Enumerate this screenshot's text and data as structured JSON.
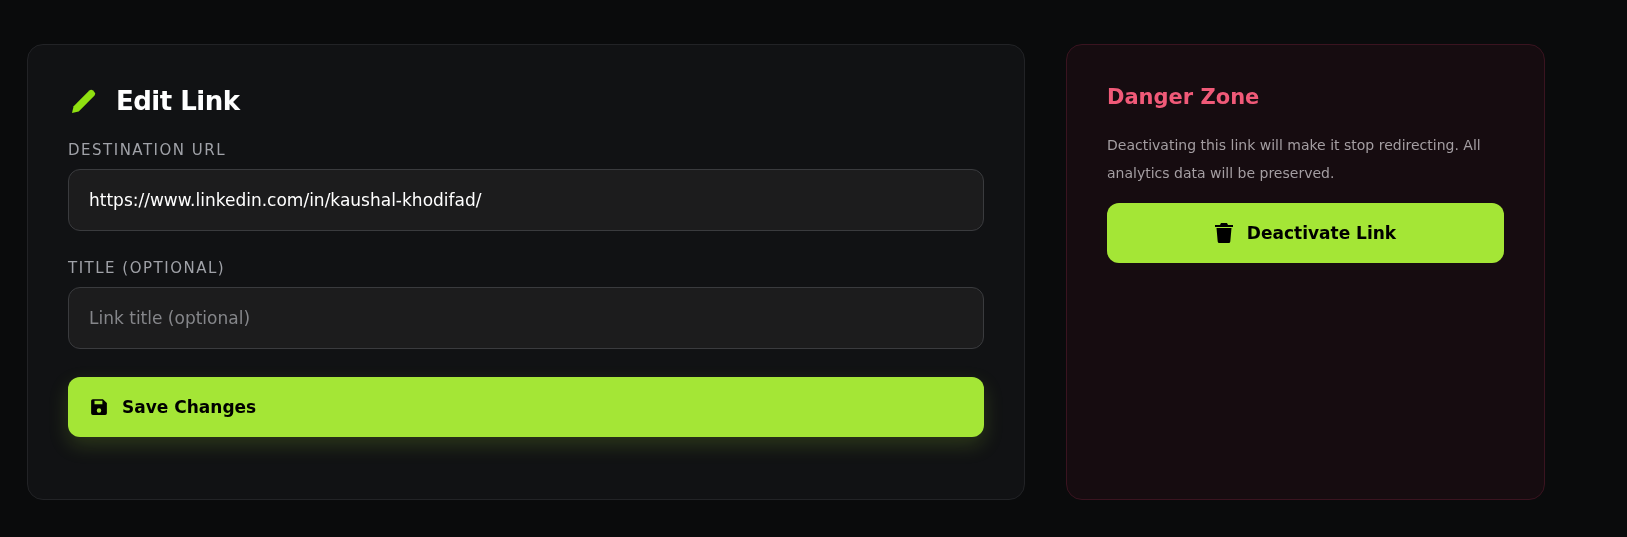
{
  "edit_card": {
    "title": "Edit Link",
    "fields": [
      {
        "label": "DESTINATION URL",
        "value": "https://www.linkedin.com/in/kaushal-khodifad/"
      },
      {
        "label": "TITLE (OPTIONAL)",
        "placeholder": "Link title (optional)"
      }
    ],
    "save_button": "Save Changes"
  },
  "danger_card": {
    "title": "Danger Zone",
    "description": "Deactivating this link will make it stop redirecting. All analytics data will be preserved.",
    "button": "Deactivate Link"
  }
}
